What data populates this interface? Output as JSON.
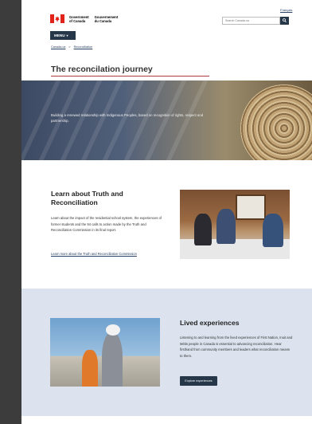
{
  "header": {
    "language_link": "Français",
    "signature_en": [
      "Government",
      "of Canada"
    ],
    "signature_fr": [
      "Gouvernement",
      "du Canada"
    ],
    "search_placeholder": "Search Canada.ca",
    "search_icon": "search-icon"
  },
  "menu": {
    "label": "MENU",
    "icon": "chevron-down-icon"
  },
  "breadcrumb": {
    "items": [
      "Canada.ca",
      "Reconciliation"
    ],
    "separator": ">"
  },
  "page": {
    "title": "The reconcilation journey"
  },
  "hero": {
    "text": "Building a renewed relationship with Indigenous Peoples, based on recognition of rights, respect and partnership."
  },
  "truth": {
    "title": "Learn about Truth and Reconciliation",
    "body": "Learn about the impact of the residential school system, the experiences of former students and the 94 calls to action made by the Truth and Reconciliation Commission in its final report.",
    "link": "Learn more about the Truth and Reconciliation Commission"
  },
  "lived": {
    "title": "Lived experiences",
    "body": "Listening to and learning from the lived experiences of First Nation, Inuit and Métis people in Canada is essential to advancing reconciliation. Hear firsthand from community members and leaders what reconciliation means to them.",
    "button": "Explore experiences"
  },
  "colors": {
    "navy": "#26374a",
    "link": "#284162",
    "accent_rule": "#af3c43",
    "band": "#dce3ee"
  }
}
